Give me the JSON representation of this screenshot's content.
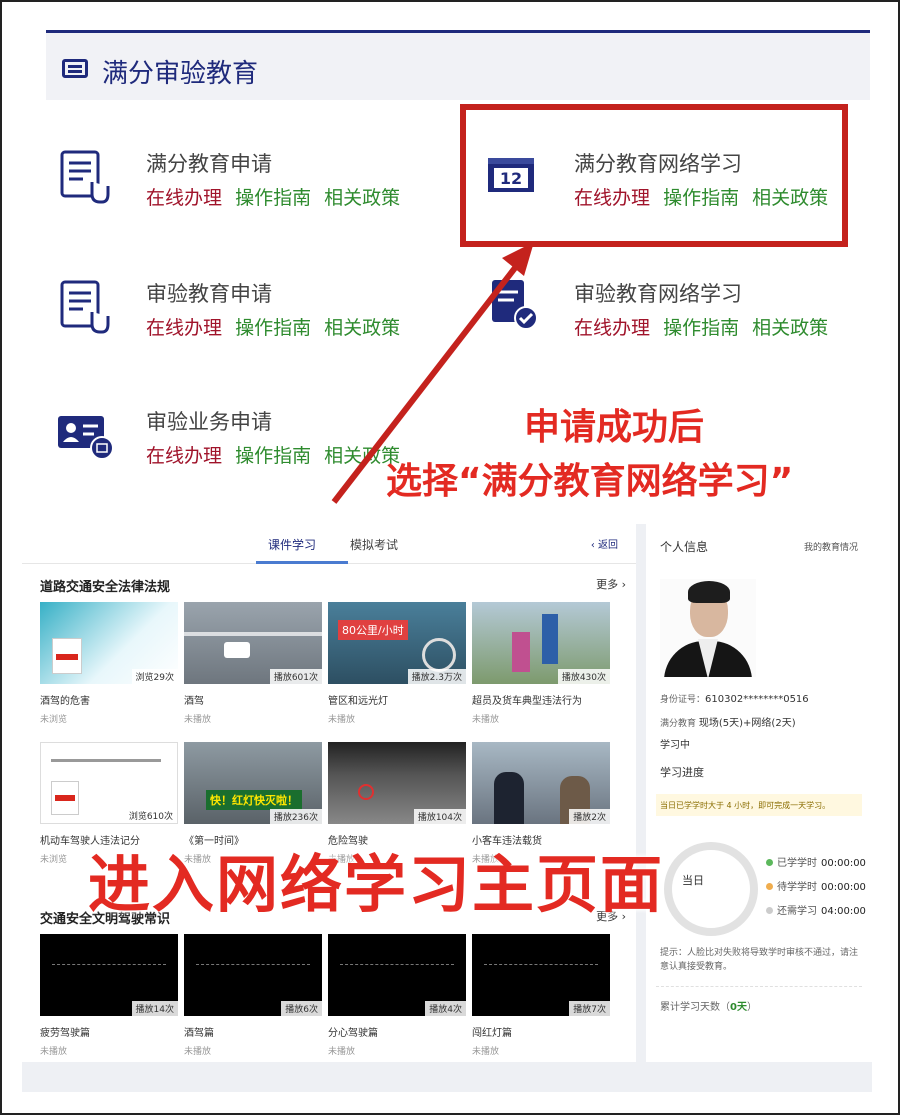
{
  "top_panel": {
    "title": "满分审验教育",
    "services": [
      {
        "title": "满分教育申请",
        "icon": "form-hand-icon",
        "links": [
          "在线办理",
          "操作指南",
          "相关政策"
        ]
      },
      {
        "title": "满分教育网络学习",
        "icon": "calendar-12-icon",
        "links": [
          "在线办理",
          "操作指南",
          "相关政策"
        ]
      },
      {
        "title": "审验教育申请",
        "icon": "form-hand-icon",
        "links": [
          "在线办理",
          "操作指南",
          "相关政策"
        ]
      },
      {
        "title": "审验教育网络学习",
        "icon": "doc-check-icon",
        "links": [
          "在线办理",
          "操作指南",
          "相关政策"
        ]
      },
      {
        "title": "审验业务申请",
        "icon": "id-card-icon",
        "links": [
          "在线办理",
          "操作指南",
          "相关政策"
        ]
      }
    ],
    "calendar_number": "12"
  },
  "annotations": {
    "line1": "申请成功后",
    "line2": "选择“满分教育网络学习”",
    "line3": "进入网络学习主页面"
  },
  "colors": {
    "accent": "#1f2a7c",
    "link_red": "#a0132a",
    "link_green": "#2e8b2e",
    "annotation": "#e32a22"
  },
  "screenshot": {
    "tabs": [
      "课件学习",
      "模拟考试"
    ],
    "back_label": "返回",
    "section1": {
      "title": "道路交通安全法律法规",
      "more": "更多",
      "cards": [
        {
          "title": "酒驾的危害",
          "count": "浏览29次",
          "status": "未浏览"
        },
        {
          "title": "酒驾",
          "count": "播放601次",
          "status": "未播放"
        },
        {
          "title": "管区和远光灯",
          "count": "播放2.3万次",
          "status": "未播放",
          "banner": "80公里/小时"
        },
        {
          "title": "超员及货车典型违法行为",
          "count": "播放430次",
          "status": "未播放"
        },
        {
          "title": "机动车驾驶人违法记分",
          "count": "浏览610次",
          "status": "未浏览"
        },
        {
          "title": "《第一时间》",
          "count": "播放236次",
          "status": "未播放",
          "banner": "快！红灯快灭啦！"
        },
        {
          "title": "危险驾驶",
          "count": "播放104次",
          "status": "未播放"
        },
        {
          "title": "小客车违法载货",
          "count": "播放2次",
          "status": "未播放"
        }
      ]
    },
    "section2": {
      "title": "交通安全文明驾驶常识",
      "more": "更多",
      "cards": [
        {
          "title": "疲劳驾驶篇",
          "count": "播放14次",
          "status": "未播放"
        },
        {
          "title": "酒驾篇",
          "count": "播放6次",
          "status": "未播放"
        },
        {
          "title": "分心驾驶篇",
          "count": "播放4次",
          "status": "未播放"
        },
        {
          "title": "闯红灯篇",
          "count": "播放7次",
          "status": "未播放"
        }
      ]
    },
    "side": {
      "title": "个人信息",
      "link": "我的教育情况",
      "id_label": "身份证号",
      "id_value": "610302********0516",
      "edu_label": "满分教育",
      "edu_value": "现场(5天)+网络(2天)",
      "state": "学习中",
      "progress_title": "学习进度",
      "notice": "当日已学学时大于 4 小时，即可完成一天学习。",
      "ring_label": "当日",
      "legend": [
        {
          "label": "已学学时",
          "value": "00:00:00",
          "color": "#5cb85c"
        },
        {
          "label": "待学学时",
          "value": "00:00:00",
          "color": "#f0ad4e"
        },
        {
          "label": "还需学习",
          "value": "04:00:00",
          "color": "#cccccc"
        }
      ],
      "hint": "提示：人脸比对失败将导致学时审核不通过，请注意认真接受教育。",
      "days_label": "累计学习天数",
      "days_value": "0天"
    }
  }
}
